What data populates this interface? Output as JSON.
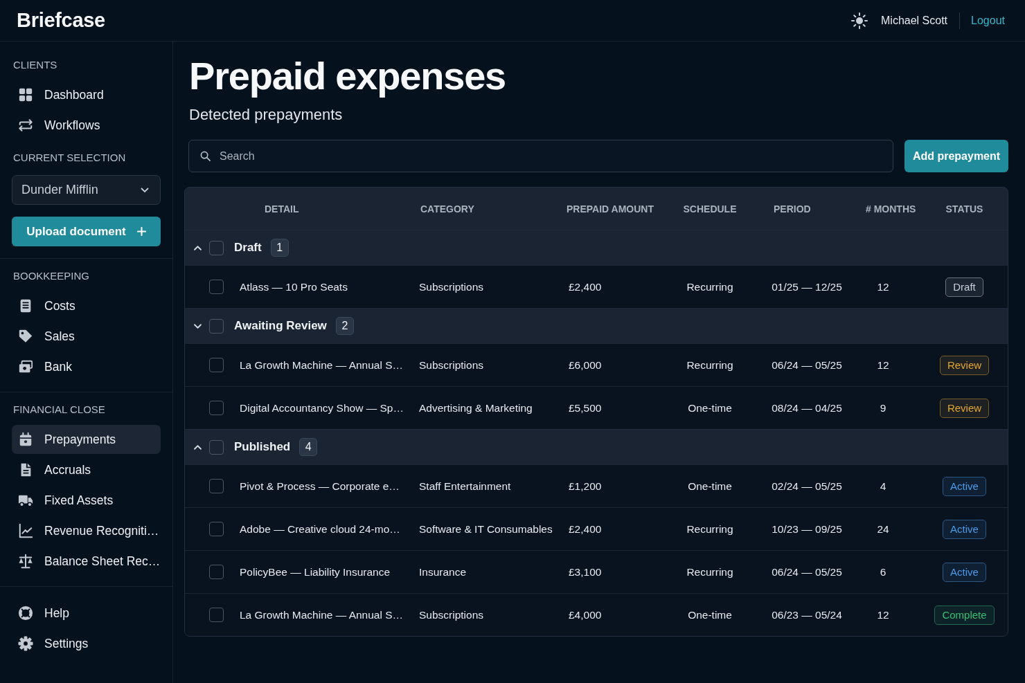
{
  "top_bar": {
    "brand": "Briefcase",
    "user_name": "Michael Scott",
    "logout": "Logout"
  },
  "sidebar": {
    "blocks": [
      {
        "sections": [
          {
            "kind": "nav",
            "label": "CLIENTS",
            "items": [
              {
                "label": "Dashboard",
                "selected": false
              },
              {
                "label": "Workflows",
                "selected": false
              }
            ]
          },
          {
            "kind": "selection",
            "label": "CURRENT SELECTION",
            "dropdown": {
              "value": "Dunder Mifflin"
            },
            "upload_button": "Upload document"
          }
        ]
      },
      {
        "sections": [
          {
            "kind": "nav",
            "label": "BOOKKEEPING",
            "items": [
              {
                "label": "Costs",
                "selected": false
              },
              {
                "label": "Sales",
                "selected": false
              },
              {
                "label": "Bank",
                "selected": false
              }
            ]
          }
        ]
      },
      {
        "sections": [
          {
            "kind": "nav",
            "label": "FINANCIAL CLOSE",
            "items": [
              {
                "label": "Prepayments",
                "selected": true
              },
              {
                "label": "Accruals",
                "selected": false
              },
              {
                "label": "Fixed Assets",
                "selected": false
              },
              {
                "label": "Revenue Recogniti…",
                "selected": false
              },
              {
                "label": "Balance Sheet Rec…",
                "selected": false
              }
            ]
          }
        ]
      },
      {
        "sections": [
          {
            "kind": "nav",
            "items": [
              {
                "label": "Help",
                "selected": false
              },
              {
                "label": "Settings",
                "selected": false
              }
            ]
          }
        ]
      }
    ]
  },
  "page": {
    "title": "Prepaid expenses",
    "subtitle": "Detected prepayments",
    "search": {
      "placeholder": "Search"
    },
    "add_button": "Add prepayment"
  },
  "table": {
    "columns": [
      "DETAIL",
      "CATEGORY",
      "PREPAID AMOUNT",
      "SCHEDULE",
      "PERIOD",
      "# MONTHS",
      "STATUS"
    ],
    "groups": [
      {
        "label": "Draft",
        "count": "1",
        "expanded": true,
        "checked": false,
        "rows": [
          {
            "checked": false,
            "detail": "Atlass — 10 Pro Seats",
            "category": "Subscriptions",
            "prepaid_amount": "£2,400",
            "schedule": "Recurring",
            "period": "01/25 — 12/25",
            "months": "12",
            "status": {
              "label": "Draft",
              "color": "#c9d0d8"
            }
          }
        ]
      },
      {
        "label": "Awaiting Review",
        "count": "2",
        "expanded": false,
        "checked": false,
        "rows": [
          {
            "checked": false,
            "detail": "La Growth Machine — Annual S…",
            "category": "Subscriptions",
            "prepaid_amount": "£6,000",
            "schedule": "Recurring",
            "period": "06/24 — 05/25",
            "months": "12",
            "status": {
              "label": "Review",
              "color": "#e3a72b"
            }
          },
          {
            "checked": false,
            "detail": "Digital Accountancy Show — Sp…",
            "category": "Advertising & Marketing",
            "prepaid_amount": "£5,500",
            "schedule": "One-time",
            "period": "08/24 — 04/25",
            "months": "9",
            "status": {
              "label": "Review",
              "color": "#e3a72b"
            }
          }
        ]
      },
      {
        "label": "Published",
        "count": "4",
        "expanded": true,
        "checked": false,
        "rows": [
          {
            "checked": false,
            "detail": "Pivot & Process — Corporate e…",
            "category": "Staff Entertainment",
            "prepaid_amount": "£1,200",
            "schedule": "One-time",
            "period": "02/24 — 05/25",
            "months": "4",
            "status": {
              "label": "Active",
              "color": "#4a9be8"
            }
          },
          {
            "checked": false,
            "detail": "Adobe — Creative cloud 24-mo…",
            "category": "Software & IT Consumables",
            "prepaid_amount": "£2,400",
            "schedule": "Recurring",
            "period": "10/23 — 09/25",
            "months": "24",
            "status": {
              "label": "Active",
              "color": "#4a9be8"
            }
          },
          {
            "checked": false,
            "detail": "PolicyBee — Liability Insurance",
            "category": "Insurance",
            "prepaid_amount": "£3,100",
            "schedule": "Recurring",
            "period": "06/24 — 05/25",
            "months": "6",
            "status": {
              "label": "Active",
              "color": "#4a9be8"
            }
          },
          {
            "checked": false,
            "detail": "La Growth Machine — Annual S…",
            "category": "Subscriptions",
            "prepaid_amount": "£4,000",
            "schedule": "One-time",
            "period": "06/23 — 05/24",
            "months": "12",
            "status": {
              "label": "Complete",
              "color": "#34c072"
            }
          }
        ]
      }
    ]
  }
}
